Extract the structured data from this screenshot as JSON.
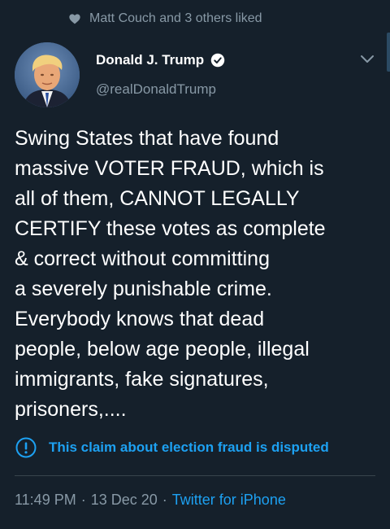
{
  "social_context": {
    "icon": "heart-icon",
    "text": "Matt Couch and 3 others liked"
  },
  "author": {
    "display_name": "Donald J. Trump",
    "handle": "@realDonaldTrump",
    "verified": true
  },
  "tweet": {
    "lines": [
      "Swing States that have found",
      "massive VOTER FRAUD, which is",
      "all of them, CANNOT LEGALLY",
      "CERTIFY these votes as complete",
      "& correct without committing",
      "a severely punishable crime.",
      "Everybody knows that dead",
      "people, below age people, illegal",
      "immigrants, fake signatures,",
      "prisoners,...."
    ]
  },
  "notice": {
    "icon": "exclamation-circle-icon",
    "text": "This claim about election fraud is disputed"
  },
  "meta": {
    "time": "11:49 PM",
    "separator": "·",
    "date": "13 Dec 20",
    "source": "Twitter for iPhone"
  },
  "colors": {
    "background": "#15202b",
    "text": "#ffffff",
    "muted": "#8899a6",
    "accent": "#1da1f2",
    "divider": "#38444d"
  }
}
